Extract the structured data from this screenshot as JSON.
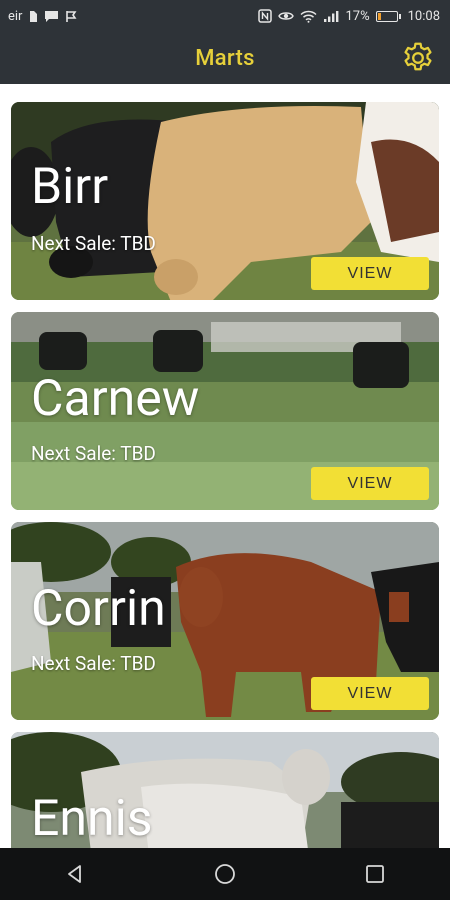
{
  "status_bar": {
    "carrier": "eir",
    "battery_text": "17%",
    "time": "10:08",
    "battery_level": 0.17
  },
  "app_bar": {
    "title": "Marts",
    "title_color": "#e6d03a",
    "settings_icon": "gear-icon"
  },
  "marts": [
    {
      "name": "Birr",
      "sale_label": "Next Sale: TBD",
      "button_label": "VIEW"
    },
    {
      "name": "Carnew",
      "sale_label": "Next Sale: TBD",
      "button_label": "VIEW"
    },
    {
      "name": "Corrin",
      "sale_label": "Next Sale: TBD",
      "button_label": "VIEW"
    },
    {
      "name": "Ennis"
    }
  ],
  "nav": {
    "back_icon": "back-icon",
    "home_icon": "home-icon",
    "recents_icon": "recents-icon"
  },
  "colors": {
    "bars": "#2e3338",
    "accent_button": "#f2df35",
    "nav_bar": "#111213"
  }
}
